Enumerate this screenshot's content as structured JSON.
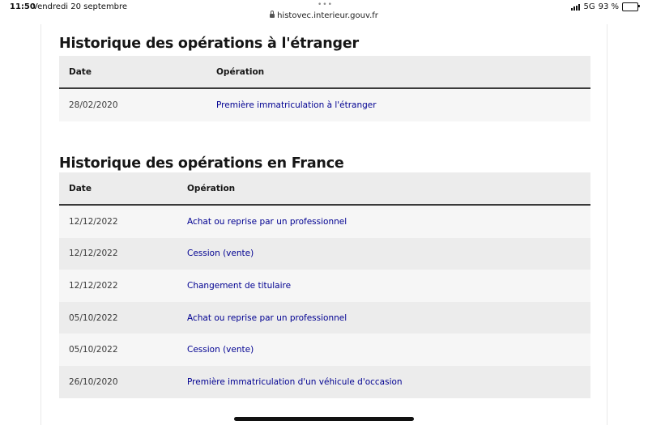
{
  "status_bar": {
    "time": "11:50",
    "date": "Vendredi 20 septembre",
    "more_dots": "•••",
    "url": "histovec.interieur.gouv.fr",
    "network": "5G",
    "battery": "93 %",
    "battery_level": 0.93
  },
  "foreign_section": {
    "title": "Historique des opérations à l'étranger",
    "columns": [
      "Date",
      "Opération"
    ],
    "rows": [
      {
        "date": "28/02/2020",
        "operation": "Première immatriculation à l'étranger"
      }
    ]
  },
  "france_section": {
    "title": "Historique des opérations en France",
    "columns": [
      "Date",
      "Opération"
    ],
    "rows": [
      {
        "date": "12/12/2022",
        "operation": "Achat ou reprise par un professionnel"
      },
      {
        "date": "12/12/2022",
        "operation": "Cession (vente)"
      },
      {
        "date": "12/12/2022",
        "operation": "Changement de titulaire"
      },
      {
        "date": "05/10/2022",
        "operation": "Achat ou reprise par un professionnel"
      },
      {
        "date": "05/10/2022",
        "operation": "Cession (vente)"
      },
      {
        "date": "26/10/2020",
        "operation": "Première immatriculation d'un véhicule d'occasion"
      }
    ]
  },
  "colors": {
    "link": "#000091",
    "header_bg": "#ececec",
    "row_alt_bg": "#f6f6f6",
    "text": "#161616"
  }
}
